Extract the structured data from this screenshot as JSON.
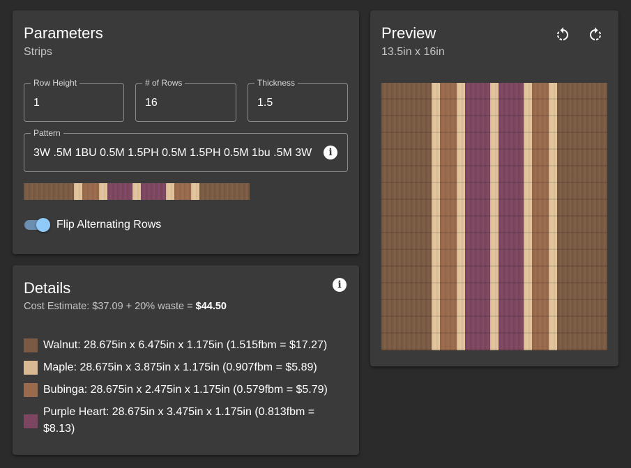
{
  "parameters": {
    "title": "Parameters",
    "subtitle": "Strips",
    "row_height": {
      "label": "Row Height",
      "value": "1"
    },
    "num_rows": {
      "label": "# of Rows",
      "value": "16"
    },
    "thickness": {
      "label": "Thickness",
      "value": "1.5"
    },
    "pattern": {
      "label": "Pattern",
      "value": "3W .5M 1BU 0.5M 1.5PH 0.5M 1.5PH 0.5M 1bu .5M 3W"
    },
    "flip_toggle": {
      "label": "Flip Alternating Rows",
      "checked": true
    }
  },
  "details": {
    "title": "Details",
    "cost_prefix": "Cost Estimate: $37.09 + 20% waste = ",
    "cost_total": "$44.50",
    "materials": [
      {
        "name": "Walnut",
        "text": "Walnut: 28.675in x 6.475in x 1.175in (1.515fbm = $17.27)",
        "color": "#7a5a43"
      },
      {
        "name": "Maple",
        "text": "Maple: 28.675in x 3.875in x 1.175in (0.907fbm = $5.89)",
        "color": "#d9b993"
      },
      {
        "name": "Bubinga",
        "text": "Bubinga: 28.675in x 2.475in x 1.175in (0.579fbm = $5.79)",
        "color": "#9a6a4c"
      },
      {
        "name": "Purple Heart",
        "text": "Purple Heart: 28.675in x 3.475in x 1.175in (0.813fbm = $8.13)",
        "color": "#7d4660"
      }
    ]
  },
  "preview": {
    "title": "Preview",
    "subtitle": "13.5in x 16in",
    "rotate_left_icon": "rotate-left-icon",
    "rotate_right_icon": "rotate-right-icon"
  },
  "colors": {
    "walnut": "#7a5a43",
    "maple": "#e2c49c",
    "bubinga": "#9a6a4c",
    "purpleheart": "#7d4660",
    "accent": "#90caf9"
  },
  "strips": [
    {
      "wood": "walnut",
      "width": 3
    },
    {
      "wood": "maple",
      "width": 0.5
    },
    {
      "wood": "bubinga",
      "width": 1
    },
    {
      "wood": "maple",
      "width": 0.5
    },
    {
      "wood": "purpleheart",
      "width": 1.5
    },
    {
      "wood": "maple",
      "width": 0.5
    },
    {
      "wood": "purpleheart",
      "width": 1.5
    },
    {
      "wood": "maple",
      "width": 0.5
    },
    {
      "wood": "bubinga",
      "width": 1
    },
    {
      "wood": "maple",
      "width": 0.5
    },
    {
      "wood": "walnut",
      "width": 3
    }
  ]
}
